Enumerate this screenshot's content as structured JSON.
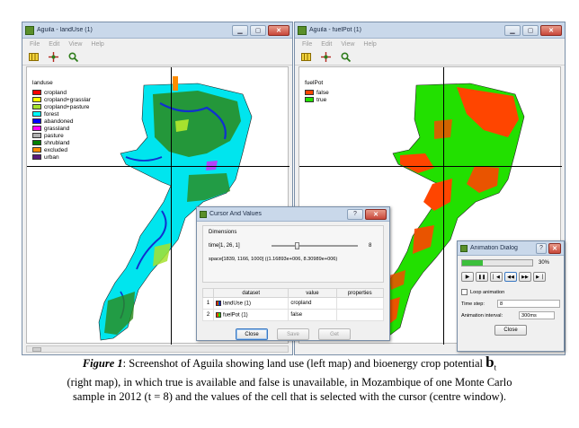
{
  "left_window": {
    "title": "Aguila - landUse (1)",
    "menu": [
      "File",
      "Edit",
      "View",
      "Help"
    ],
    "toolbar_icons": [
      "legend-icon",
      "cursor-icon",
      "zoom-icon"
    ],
    "legend_title": "landuse",
    "legend": [
      {
        "label": "cropland",
        "color": "#ff0000"
      },
      {
        "label": "cropland+grasslar",
        "color": "#ffff00"
      },
      {
        "label": "cropland+pasture",
        "color": "#a6e22e"
      },
      {
        "label": "forest",
        "color": "#00ffff"
      },
      {
        "label": "abandoned",
        "color": "#0000ff"
      },
      {
        "label": "grassland",
        "color": "#ff00ff"
      },
      {
        "label": "pasture",
        "color": "#b0b0b0"
      },
      {
        "label": "shrubland",
        "color": "#008000"
      },
      {
        "label": "excluded",
        "color": "#ff8c00"
      },
      {
        "label": "urban",
        "color": "#5a1a7a"
      }
    ]
  },
  "right_window": {
    "title": "Aguila - fuelPot (1)",
    "menu": [
      "File",
      "Edit",
      "View",
      "Help"
    ],
    "toolbar_icons": [
      "legend-icon",
      "cursor-icon",
      "zoom-icon"
    ],
    "legend_title": "fuelPot",
    "legend": [
      {
        "label": "false",
        "color": "#ff4500"
      },
      {
        "label": "true",
        "color": "#22e000"
      }
    ]
  },
  "cursor_dialog": {
    "title": "Cursor And Values",
    "help_glyph": "?",
    "close_glyph": "✕",
    "dimensions_label": "Dimensions",
    "time_label": "time[1, 26, 1]",
    "time_value": "8",
    "space_label": "space[1839, 1166, 1000] ((1.16893e+006, 8.30989e+006)",
    "table_headers": [
      "dataset",
      "value",
      "properties"
    ],
    "rows": [
      {
        "index": "1",
        "dataset": "landUse (1)",
        "value": "cropland",
        "properties": ""
      },
      {
        "index": "2",
        "dataset": "fuelPot (1)",
        "value": "false",
        "properties": ""
      }
    ],
    "buttons": {
      "close": "Close",
      "save": "Save",
      "get": "Get"
    }
  },
  "animation_dialog": {
    "title": "Animation Dialog",
    "help_glyph": "?",
    "close_glyph": "✕",
    "progress_percent": 30,
    "progress_label": "30%",
    "control_glyphs": [
      "▶",
      "❚❚",
      "▏◀",
      "◀◀",
      "▶▶",
      "▶▕"
    ],
    "loop_label": "Loop animation",
    "time_step_label": "Time step:",
    "time_step_value": "8",
    "interval_label": "Animation interval:",
    "interval_value": "300ms",
    "close_button": "Close"
  },
  "caption": {
    "figure_label": "Figure 1",
    "text_part1": ": Screenshot of Aguila showing land use (left map) and bioenergy crop potential",
    "mark": "b",
    "mark_sub": "t",
    "text_part2": "(right map), in which true is available and false is unavailable, in Mozambique of one Monte Carlo",
    "text_part3": "sample in 2012 (t = 8) and the values of the cell that is selected with the cursor (centre window)."
  }
}
